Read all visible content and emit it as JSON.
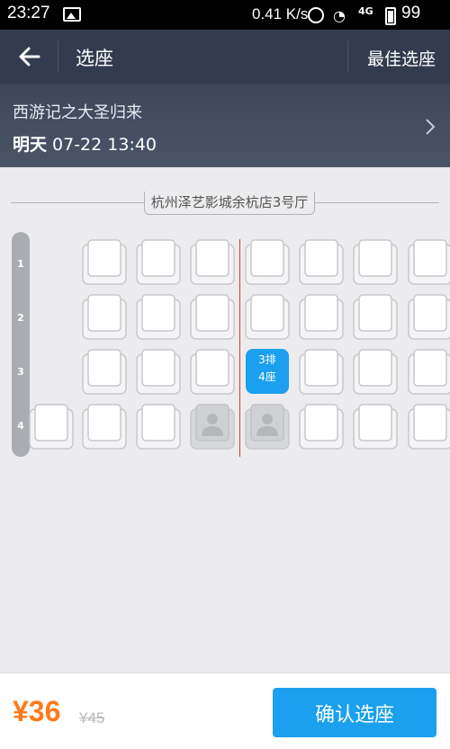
{
  "status_bar": {
    "time": "23:27",
    "speed": "0.41 K/s",
    "network": "4G",
    "battery": "99"
  },
  "nav": {
    "title": "选座",
    "best_seat": "最佳选座"
  },
  "movie": {
    "name": "西游记之大圣归来",
    "day": "明天",
    "datetime": "07-22 13:40"
  },
  "hall": {
    "name": "杭州泽艺影城余杭店3号厅"
  },
  "rows": [
    "1",
    "2",
    "3",
    "4"
  ],
  "seat_rows": [
    [
      "empty",
      "available",
      "available",
      "available",
      "available",
      "available",
      "available",
      "available"
    ],
    [
      "empty",
      "available",
      "available",
      "available",
      "available",
      "available",
      "available",
      "available"
    ],
    [
      "empty",
      "available",
      "available",
      "available",
      "selected",
      "available",
      "available",
      "available"
    ],
    [
      "available",
      "available",
      "available",
      "occupied",
      "occupied",
      "available",
      "available",
      "available"
    ]
  ],
  "selected_seat": {
    "row_label": "3排",
    "seat_label": "4座"
  },
  "footer": {
    "price": "¥36",
    "original_price": "¥45",
    "confirm_label": "确认选座"
  },
  "colors": {
    "accent": "#1aa0ee",
    "price": "#ff7a1a",
    "center_line": "#e03030",
    "nav_bg": "#323c4e"
  }
}
